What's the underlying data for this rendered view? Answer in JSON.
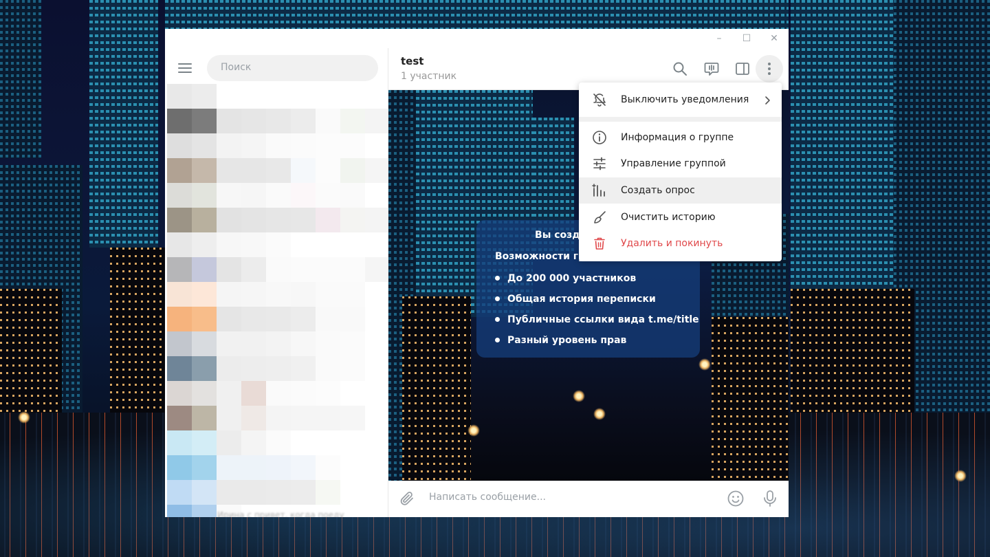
{
  "window": {
    "controls": {
      "minimize": "–",
      "maximize": "☐",
      "close": "✕"
    }
  },
  "sidebar": {
    "search": {
      "placeholder": "Поиск"
    },
    "chat_rows": [
      [
        "#e8e8e8",
        "#ececec"
      ],
      [
        "#6e6e6e",
        "#7c7c7c",
        "#e4e4e4",
        "#e6e6e6",
        "#e8e8e8",
        "#ececec",
        "#fafafa",
        "#f3f6f1",
        "#f4f4f4"
      ],
      [
        "#dedede",
        "#e4e4e4",
        "#f3f3f3",
        "#f5f5f5",
        "#fafafa",
        "#fbfbfb",
        "#fcfcfc",
        "#fcfcfc"
      ],
      [
        "#b1a293",
        "#c5b8aa",
        "#e6e6e6",
        "#e6e6e6",
        "#e8e8e8",
        "#f5f8fb",
        "#fcfcfc",
        "#f1f4ef",
        "#f5f5f5"
      ],
      [
        "#dcdcd8",
        "#e2e4dd",
        "#f7f7f7",
        "#f6f6f6",
        "#fafafa",
        "#fcf7f9",
        "#fbfbfb",
        "#fafafa"
      ],
      [
        "#9c9486",
        "#b8b09e",
        "#e2e2e2",
        "#e4e4e4",
        "#e6e6e6",
        "#e7e7e7",
        "#f3e9ee",
        "#f4f4f2",
        "#f4f4f4"
      ],
      [
        "#e7e7e7",
        "#eeeeee",
        "#f7f7f7",
        "#f8f8f8",
        "#fbfbfb"
      ],
      [
        "#b6b6b8",
        "#c5c8dc",
        "#e4e4e4",
        "#ececec",
        "#fafafa",
        "#fbfbfb",
        "#fbfbfb",
        "#fbfbfb",
        "#f5f5f5"
      ],
      [
        "#f8e4d6",
        "#fde7d8",
        "#f5f5f5",
        "#f6f6f6",
        "#f8f8f8",
        "#f7f7f7",
        "#fafafa",
        "#fafafa"
      ],
      [
        "#f6b37d",
        "#f8bd8a",
        "#e5e5e5",
        "#e8e8e8",
        "#e9e9e9",
        "#ececec",
        "#f9f9f9",
        "#f9f9f9"
      ],
      [
        "#c2c6cd",
        "#d8dbdf",
        "#f1f1f1",
        "#f1f1f1",
        "#f3f3f3",
        "#f7f7f7",
        "#fafafa",
        "#fbfbfb"
      ],
      [
        "#6f8598",
        "#8a9eac",
        "#ececec",
        "#ededed",
        "#eeeeee",
        "#f0f0f0",
        "#fafafa",
        "#fbfbfb"
      ],
      [
        "#dbd6d3",
        "#e3e1df",
        "#f0f0f0",
        "#e9dbd6",
        "#fafafa",
        "#fbfbfb",
        "#fcfcfc"
      ],
      [
        "#9d8a82",
        "#bdb6a6",
        "#f0f0f0",
        "#efe9e6",
        "#f4f4f4",
        "#f5f5f5",
        "#f5f5f5",
        "#f6f6f6"
      ],
      [
        "#c9e8f4",
        "#d3edf6",
        "#ececec",
        "#f4f4f4",
        "#fbfbfb"
      ],
      [
        "#90c9e8",
        "#a2d3ec",
        "#edf3f9",
        "#edf3f9",
        "#eef3fa",
        "#f2f6fb",
        "#fcfcfc"
      ],
      [
        "#c0dbf4",
        "#d3e5f6",
        "#eaeaea",
        "#eaeaea",
        "#ebebeb",
        "#ececec",
        "#f6f8f3"
      ],
      [
        "#8fbde6",
        "#b0d0ee",
        "#fafafa"
      ]
    ],
    "bottom_text": "Ирина с привет, когда поеду"
  },
  "chat": {
    "title": "test",
    "subtitle": "1 участник",
    "service": {
      "title": "Вы создали группу",
      "subtitle": "Возможности групп:",
      "features": [
        "До 200 000 участников",
        "Общая история переписки",
        "Публичные ссылки вида t.me/title",
        "Разный уровень прав"
      ]
    },
    "composer": {
      "placeholder": "Написать сообщение..."
    }
  },
  "menu": {
    "mute": "Выключить уведомления",
    "info": "Информация о группе",
    "manage": "Управление группой",
    "poll": "Создать опрос",
    "clear": "Очистить историю",
    "leave": "Удалить и покинуть"
  },
  "colors": {
    "danger": "#e0484a",
    "icon_gray": "#7b8489",
    "menu_hover": "#efefef"
  }
}
